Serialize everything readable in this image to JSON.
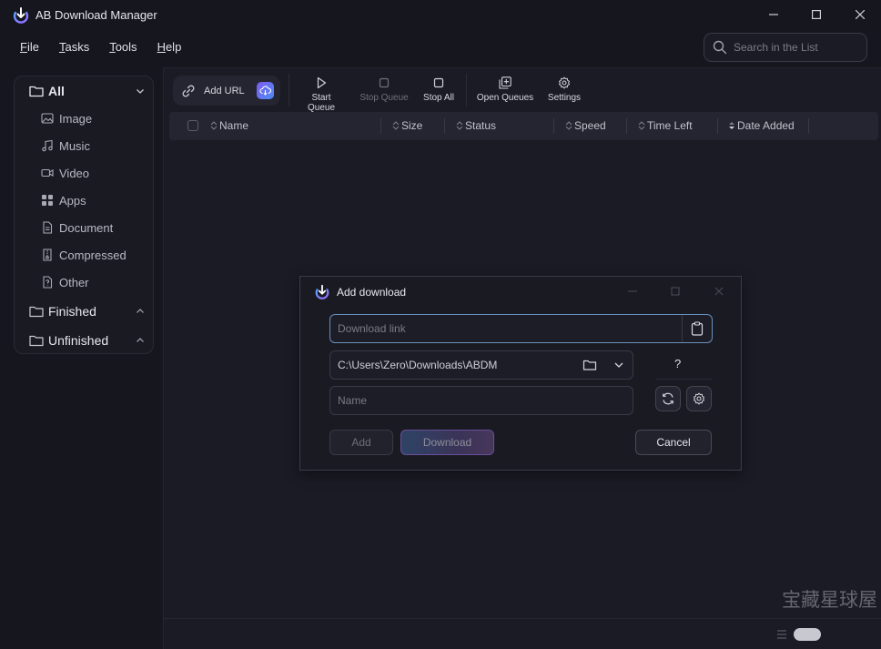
{
  "app": {
    "title": "AB Download Manager"
  },
  "menu": [
    {
      "u": "F",
      "rest": "ile"
    },
    {
      "u": "T",
      "rest": "asks"
    },
    {
      "u": "T",
      "rest": "ools"
    },
    {
      "u": "H",
      "rest": "elp"
    }
  ],
  "search": {
    "placeholder": "Search in the List"
  },
  "sidebar": {
    "all": "All",
    "items": [
      "Image",
      "Music",
      "Video",
      "Apps",
      "Document",
      "Compressed",
      "Other"
    ],
    "finished": "Finished",
    "unfinished": "Unfinished"
  },
  "toolbar": {
    "add_url": "Add URL",
    "start_queue": "Start Queue",
    "stop_queue": "Stop Queue",
    "stop_all": "Stop All",
    "open_queues": "Open Queues",
    "settings": "Settings"
  },
  "table": {
    "columns": [
      "Name",
      "Size",
      "Status",
      "Speed",
      "Time Left",
      "Date Added"
    ]
  },
  "dialog": {
    "title": "Add download",
    "link_placeholder": "Download link",
    "path": "C:\\Users\\Zero\\Downloads\\ABDM",
    "name_placeholder": "Name",
    "help": "?",
    "add": "Add",
    "download": "Download",
    "cancel": "Cancel"
  },
  "watermark": "宝藏星球屋",
  "colors": {
    "accent": "#7b5cf0",
    "background": "#16161f",
    "panel": "#1b1b25"
  }
}
